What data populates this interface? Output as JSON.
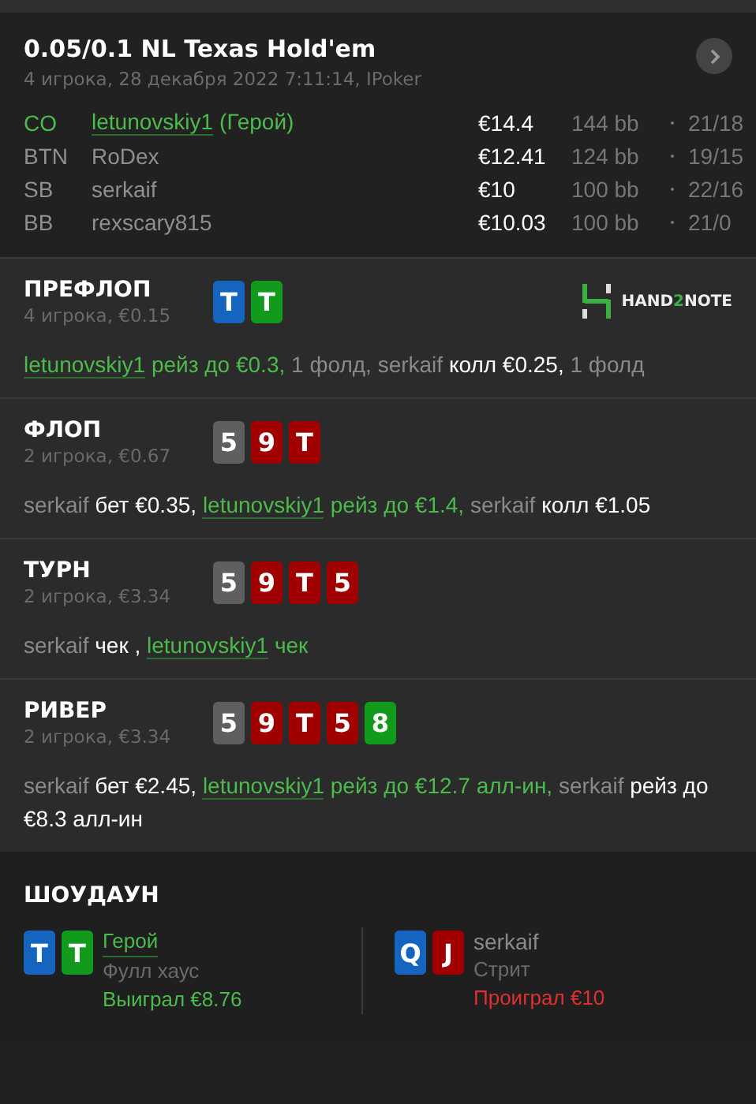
{
  "hand": {
    "title": "0.05/0.1 NL Texas Hold'em",
    "subtitle": "4 игрока, 28 декабря 2022 7:11:14, IPoker"
  },
  "players": [
    {
      "position": "CO",
      "name": "letunovskiy1",
      "hero_tag": "(Герой)",
      "is_hero": true,
      "stack": "€14.4",
      "bb": "144 bb",
      "stats": "21/18"
    },
    {
      "position": "BTN",
      "name": "RoDex",
      "is_hero": false,
      "stack": "€12.41",
      "bb": "124 bb",
      "stats": "19/15"
    },
    {
      "position": "SB",
      "name": "serkaif",
      "is_hero": false,
      "stack": "€10",
      "bb": "100 bb",
      "stats": "22/16"
    },
    {
      "position": "BB",
      "name": "rexscary815",
      "is_hero": false,
      "stack": "€10.03",
      "bb": "100 bb",
      "stats": "21/0"
    }
  ],
  "streets": [
    {
      "title": "ПРЕФЛОП",
      "info": "4 игрока, €0.15",
      "logo": {
        "text_1": "HAND",
        "text_2": "2",
        "text_3": "NOTE"
      },
      "cards": [
        {
          "rank": "T",
          "color": "#1565c0"
        },
        {
          "rank": "T",
          "color": "#129a1c"
        }
      ],
      "actions": [
        {
          "kind": "hero",
          "text": "letunovskiy1"
        },
        {
          "kind": "hero-action",
          "text": "рейз до €0.3,"
        },
        {
          "kind": "neutral",
          "text": "1 фолд,"
        },
        {
          "kind": "player",
          "text": "serkaif"
        },
        {
          "kind": "action",
          "text": "колл €0.25,"
        },
        {
          "kind": "neutral",
          "text": "1 фолд"
        }
      ]
    },
    {
      "title": "ФЛОП",
      "info": "2 игрока, €0.67",
      "cards": [
        {
          "rank": "5",
          "color": "#5f5f5f"
        },
        {
          "rank": "9",
          "color": "#a00000"
        },
        {
          "rank": "T",
          "color": "#a00000"
        }
      ],
      "actions": [
        {
          "kind": "player",
          "text": "serkaif"
        },
        {
          "kind": "action",
          "text": "бет €0.35,"
        },
        {
          "kind": "hero",
          "text": "letunovskiy1"
        },
        {
          "kind": "hero-action",
          "text": "рейз до €1.4,"
        },
        {
          "kind": "player",
          "text": "serkaif"
        },
        {
          "kind": "action",
          "text": "колл €1.05"
        }
      ]
    },
    {
      "title": "ТУРН",
      "info": "2 игрока, €3.34",
      "cards": [
        {
          "rank": "5",
          "color": "#5f5f5f"
        },
        {
          "rank": "9",
          "color": "#a00000"
        },
        {
          "rank": "T",
          "color": "#a00000"
        },
        {
          "rank": "5",
          "color": "#a00000"
        }
      ],
      "actions": [
        {
          "kind": "player",
          "text": "serkaif"
        },
        {
          "kind": "action",
          "text": "чек ,"
        },
        {
          "kind": "hero",
          "text": "letunovskiy1"
        },
        {
          "kind": "hero-action",
          "text": "чек"
        }
      ]
    },
    {
      "title": "РИВЕР",
      "info": "2 игрока, €3.34",
      "cards": [
        {
          "rank": "5",
          "color": "#5f5f5f"
        },
        {
          "rank": "9",
          "color": "#a00000"
        },
        {
          "rank": "T",
          "color": "#a00000"
        },
        {
          "rank": "5",
          "color": "#a00000"
        },
        {
          "rank": "8",
          "color": "#129a1c"
        }
      ],
      "actions": [
        {
          "kind": "player",
          "text": "serkaif"
        },
        {
          "kind": "action",
          "text": "бет €2.45,"
        },
        {
          "kind": "hero",
          "text": "letunovskiy1"
        },
        {
          "kind": "hero-action",
          "text": "рейз до €12.7 алл-ин,"
        },
        {
          "kind": "player",
          "text": "serkaif"
        },
        {
          "kind": "action",
          "text": "рейз до €8.3 алл-ин"
        }
      ]
    }
  ],
  "showdown": {
    "title": "ШОУДАУН",
    "hands": [
      {
        "name": "Герой",
        "is_hero": true,
        "combo": "Фулл хаус",
        "result": "Выиграл €8.76",
        "won": true,
        "cards": [
          {
            "rank": "T",
            "color": "#1565c0"
          },
          {
            "rank": "T",
            "color": "#129a1c"
          }
        ]
      },
      {
        "name": "serkaif",
        "is_hero": false,
        "combo": "Стрит",
        "result": "Проиграл €10",
        "won": false,
        "cards": [
          {
            "rank": "Q",
            "color": "#1565c0"
          },
          {
            "rank": "J",
            "color": "#a00000"
          }
        ]
      }
    ]
  }
}
